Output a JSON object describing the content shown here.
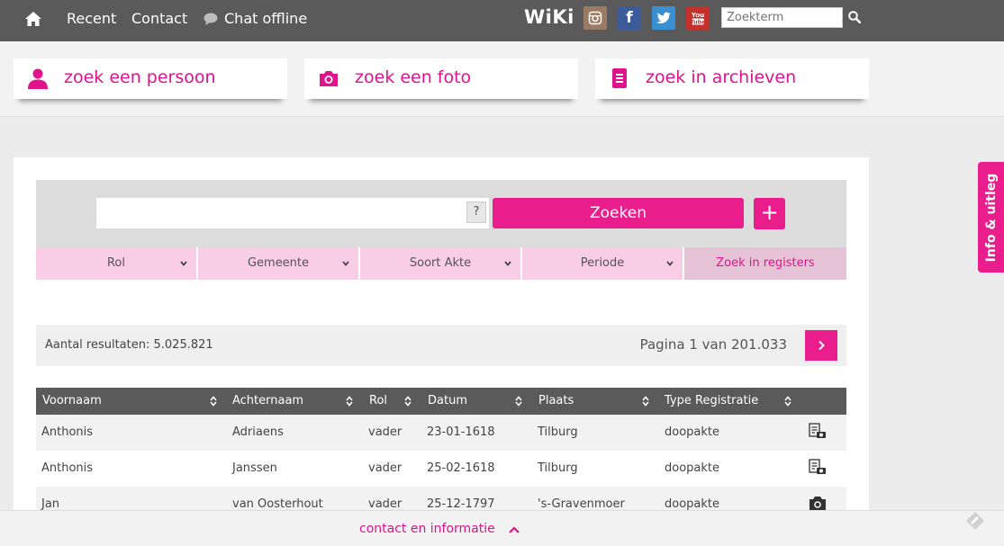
{
  "nav": {
    "recent": "Recent",
    "contact": "Contact",
    "chat": "Chat offline",
    "wiki": "WiKi",
    "search_placeholder": "Zoekterm"
  },
  "tabs": [
    {
      "label": "zoek een persoon",
      "icon": "person-icon"
    },
    {
      "label": "zoek een foto",
      "icon": "camera-icon"
    },
    {
      "label": "zoek in archieven",
      "icon": "document-icon"
    }
  ],
  "search": {
    "help": "?",
    "button": "Zoeken",
    "plus": "+"
  },
  "filters": [
    "Rol",
    "Gemeente",
    "Soort Akte",
    "Periode"
  ],
  "filter_registers": "Zoek in registers",
  "results": {
    "count": "Aantal resultaten: 5.025.821",
    "page": "Pagina 1 van 201.033"
  },
  "table": {
    "headers": [
      "Voornaam",
      "Achternaam",
      "Rol",
      "Datum",
      "Plaats",
      "Type Registratie"
    ],
    "rows": [
      [
        "Anthonis",
        "Adriaens",
        "vader",
        "23-01-1618",
        "Tilburg",
        "doopakte"
      ],
      [
        "Anthonis",
        "Janssen",
        "vader",
        "25-02-1618",
        "Tilburg",
        "doopakte"
      ],
      [
        "Jan",
        "van Oosterhout",
        "vader",
        "25-12-1797",
        "'s-Gravenmoer",
        "doopakte"
      ]
    ]
  },
  "bottom": {
    "link": "contact en informatie"
  },
  "side_tab": "Info & uitleg",
  "colors": {
    "accent": "#e91e8c",
    "nav_bg": "#5a5a5a",
    "filter_bg": "#f9cde6"
  }
}
